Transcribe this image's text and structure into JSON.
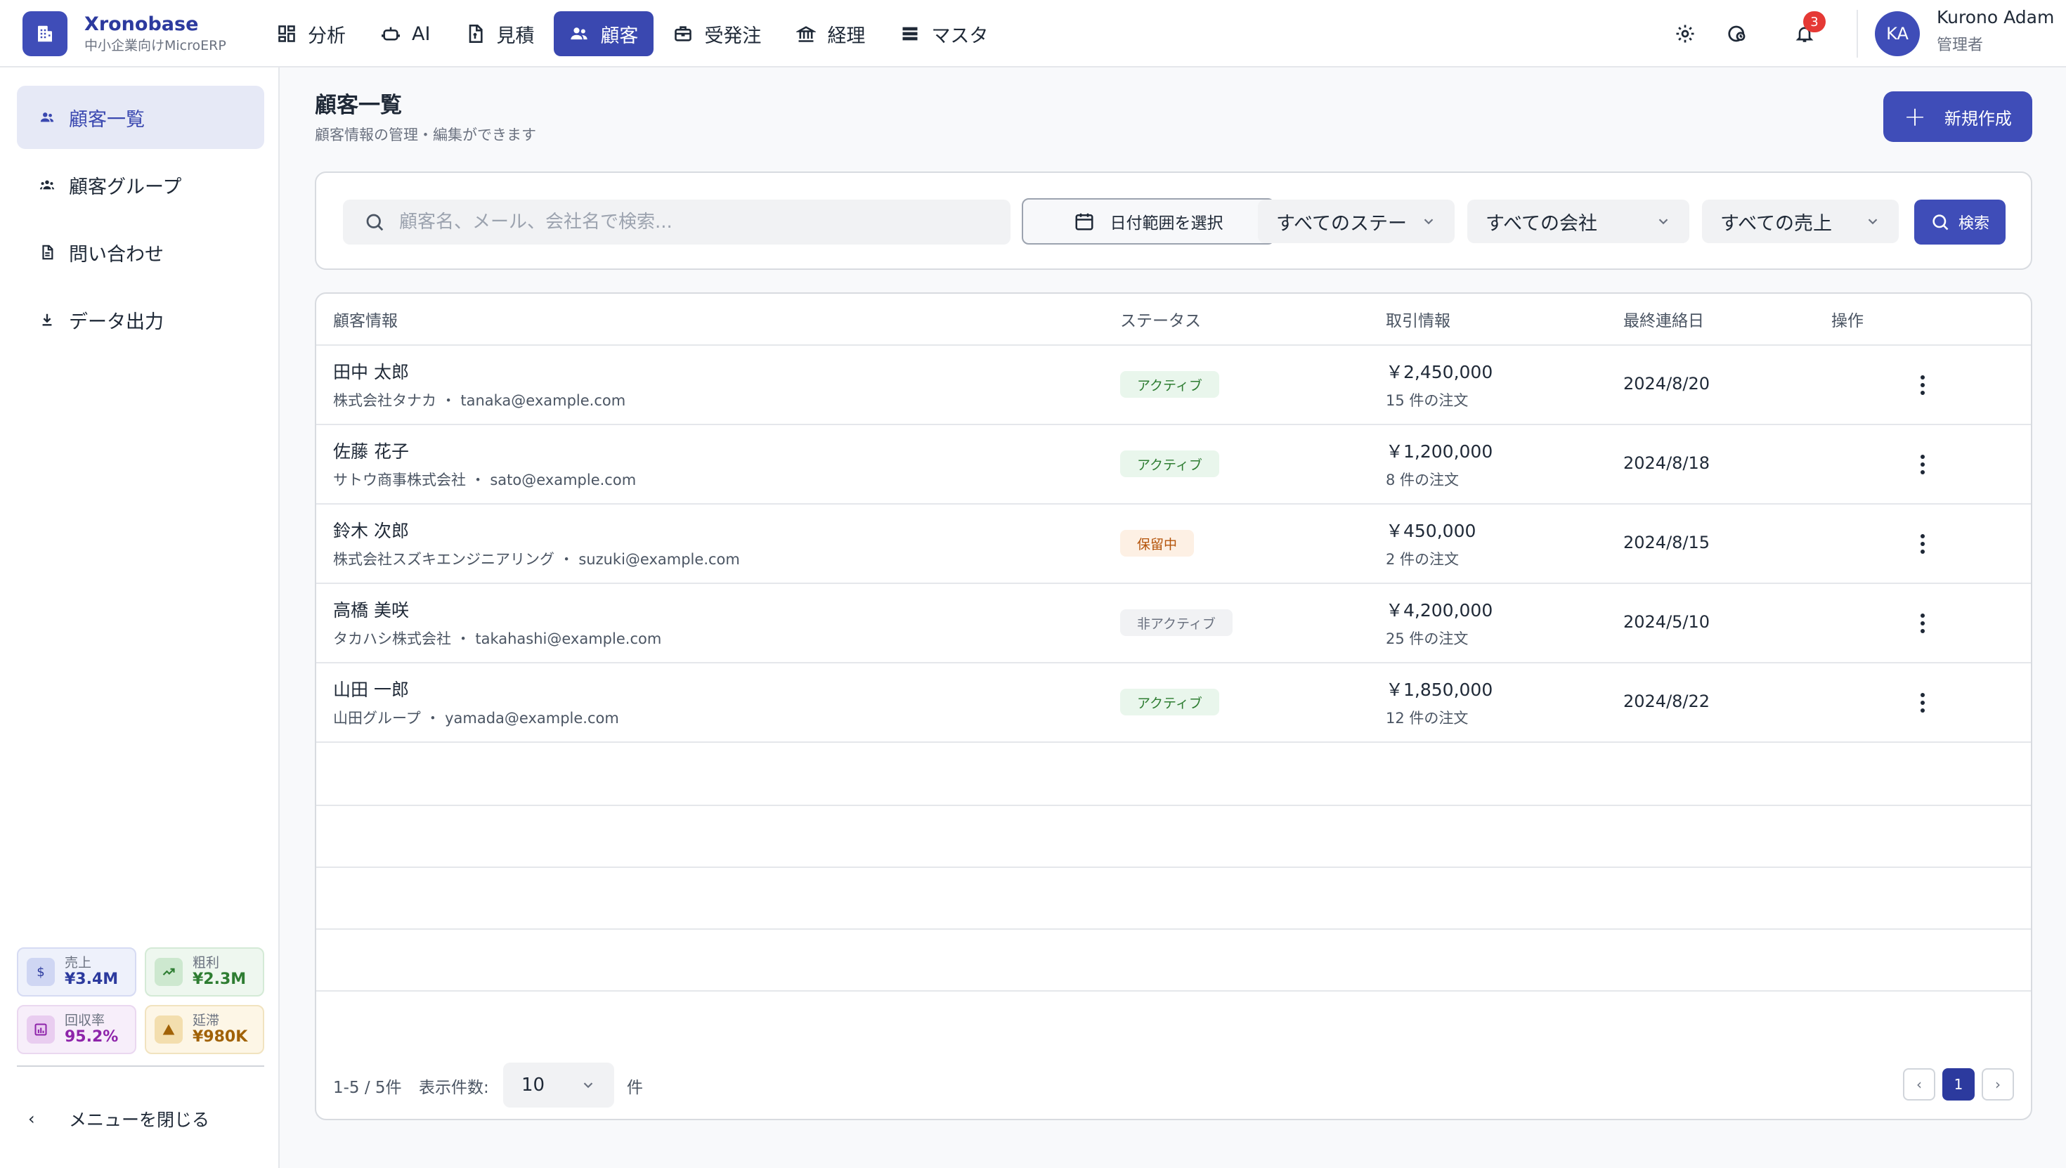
{
  "app": {
    "name": "Xronobase",
    "subtitle": "中小企業向けMicroERP"
  },
  "nav": [
    {
      "label": "分析",
      "icon": "dashboard-icon"
    },
    {
      "label": "AI",
      "icon": "robot-icon"
    },
    {
      "label": "見積",
      "icon": "document-icon"
    },
    {
      "label": "顧客",
      "icon": "people-icon",
      "active": true
    },
    {
      "label": "受発注",
      "icon": "briefcase-icon"
    },
    {
      "label": "経理",
      "icon": "bank-icon"
    },
    {
      "label": "マスタ",
      "icon": "list-icon"
    }
  ],
  "header": {
    "notification_count": "3"
  },
  "user": {
    "initials": "KA",
    "name": "Kurono Adam",
    "role": "管理者"
  },
  "sidebar": {
    "items": [
      {
        "label": "顧客一覧",
        "icon": "people-icon",
        "active": true
      },
      {
        "label": "顧客グループ",
        "icon": "groups-icon"
      },
      {
        "label": "問い合わせ",
        "icon": "document-icon"
      },
      {
        "label": "データ出力",
        "icon": "download-icon"
      }
    ],
    "kpis": [
      {
        "label": "売上",
        "value": "¥3.4M",
        "icon": "$",
        "color": "#2c3a9e",
        "bg": "#eef1fb",
        "border": "#d6dbf3",
        "iconbg": "#cfd6f3"
      },
      {
        "label": "粗利",
        "value": "¥2.3M",
        "icon": "trend",
        "color": "#2e7d32",
        "bg": "#eef7ef",
        "border": "#d4ead6",
        "iconbg": "#cde8cf"
      },
      {
        "label": "回収率",
        "value": "95.2%",
        "icon": "chart",
        "color": "#8e24aa",
        "bg": "#f7eefa",
        "border": "#ead8f0",
        "iconbg": "#e9cdf0"
      },
      {
        "label": "延滞",
        "value": "¥980K",
        "icon": "warn",
        "color": "#a16207",
        "bg": "#fdf6e6",
        "border": "#f1e3bf",
        "iconbg": "#f3deae"
      }
    ],
    "close_label": "メニューを閉じる"
  },
  "page": {
    "title": "顧客一覧",
    "subtitle": "顧客情報の管理・編集ができます",
    "new_button": "新規作成"
  },
  "filters": {
    "search_placeholder": "顧客名、メール、会社名で検索...",
    "date_label": "日付範囲を選択",
    "status_select": "すべてのステー",
    "company_select": "すべての会社",
    "sales_select": "すべての売上",
    "search_button": "検索"
  },
  "table": {
    "headers": [
      "顧客情報",
      "ステータス",
      "取引情報",
      "最終連絡日",
      "操作"
    ],
    "rows": [
      {
        "name": "田中 太郎",
        "company": "株式会社タナカ ・ tanaka@example.com",
        "status": "アクティブ",
        "status_type": "active",
        "amount": "￥2,450,000",
        "orders": "15 件の注文",
        "date": "2024/8/20"
      },
      {
        "name": "佐藤 花子",
        "company": "サトウ商事株式会社 ・ sato@example.com",
        "status": "アクティブ",
        "status_type": "active",
        "amount": "￥1,200,000",
        "orders": "8 件の注文",
        "date": "2024/8/18"
      },
      {
        "name": "鈴木 次郎",
        "company": "株式会社スズキエンジニアリング ・ suzuki@example.com",
        "status": "保留中",
        "status_type": "hold",
        "amount": "￥450,000",
        "orders": "2 件の注文",
        "date": "2024/8/15"
      },
      {
        "name": "高橋 美咲",
        "company": "タカハシ株式会社 ・ takahashi@example.com",
        "status": "非アクティブ",
        "status_type": "inactive",
        "amount": "￥4,200,000",
        "orders": "25 件の注文",
        "date": "2024/5/10"
      },
      {
        "name": "山田 一郎",
        "company": "山田グループ ・ yamada@example.com",
        "status": "アクティブ",
        "status_type": "active",
        "amount": "￥1,850,000",
        "orders": "12 件の注文",
        "date": "2024/8/22"
      }
    ]
  },
  "pagination": {
    "range": "1-5 / 5件",
    "per_page_label": "表示件数:",
    "per_page": "10",
    "unit": "件",
    "current_page": "1",
    "prev": "‹",
    "next": "›"
  }
}
